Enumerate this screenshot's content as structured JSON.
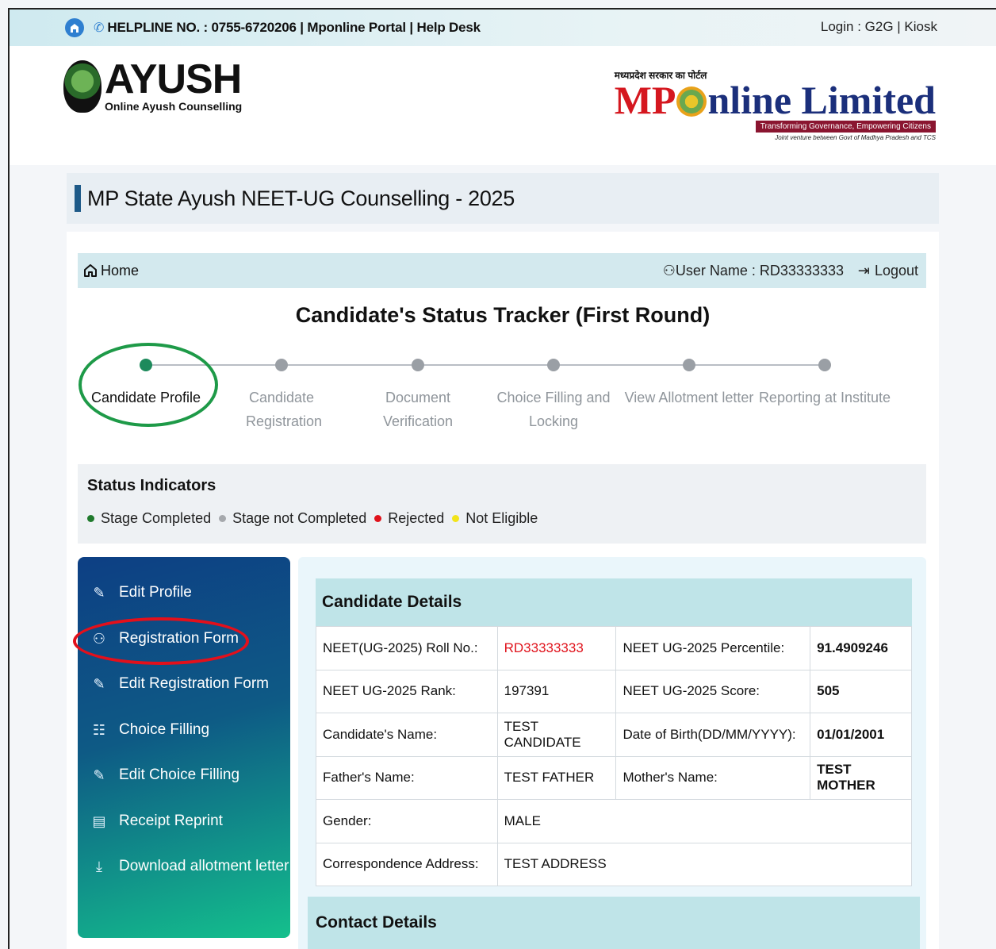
{
  "topbar": {
    "helpline": "HELPLINE NO. : 0755-6720206 | Mponline Portal | Help Desk",
    "login": "Login : G2G | Kiosk"
  },
  "header": {
    "ayush_title": "AYUSH",
    "ayush_subtitle": "Online Ayush Counselling",
    "mp_hindi": "मध्यप्रदेश सरकार का पोर्टल",
    "mp_brand_prefix": "MP",
    "mp_brand_suffix": "nline Limited",
    "mp_tagline": "Transforming Governance, Empowering Citizens",
    "mp_jv": "Joint venture between Govt of Madhya Pradesh and TCS"
  },
  "page_title": "MP State Ayush NEET-UG Counselling - 2025",
  "nav": {
    "home": "Home",
    "user": "User Name : RD33333333",
    "logout": "Logout"
  },
  "tracker": {
    "title": "Candidate's Status Tracker (First Round)",
    "steps": [
      {
        "label": "Candidate Profile",
        "done": true
      },
      {
        "label": "Candidate Registration",
        "done": false
      },
      {
        "label": "Document Verification",
        "done": false
      },
      {
        "label": "Choice Filling and Locking",
        "done": false
      },
      {
        "label": "View Allotment letter",
        "done": false
      },
      {
        "label": "Reporting at Institute",
        "done": false
      }
    ]
  },
  "status": {
    "heading": "Status Indicators",
    "items": [
      {
        "label": "Stage Completed",
        "color": "#1f7a2c"
      },
      {
        "label": "Stage not Completed",
        "color": "#a6a9ad"
      },
      {
        "label": "Rejected",
        "color": "#e0121b"
      },
      {
        "label": "Not Eligible",
        "color": "#f2e41a"
      }
    ]
  },
  "sidebar": {
    "items": [
      {
        "label": "Edit Profile",
        "icon": "edit-icon"
      },
      {
        "label": "Registration Form",
        "icon": "user-plus-icon"
      },
      {
        "label": "Edit Registration Form",
        "icon": "edit-icon"
      },
      {
        "label": "Choice Filling",
        "icon": "list-icon"
      },
      {
        "label": "Edit Choice Filling",
        "icon": "edit-icon"
      },
      {
        "label": "Receipt Reprint",
        "icon": "receipt-icon"
      },
      {
        "label": "Download allotment letter",
        "icon": "download-icon"
      }
    ]
  },
  "details": {
    "heading": "Candidate Details",
    "rows": [
      {
        "k1": "NEET(UG-2025) Roll No.:",
        "v1": "RD33333333",
        "k2": "NEET UG-2025 Percentile:",
        "v2": "91.4909246"
      },
      {
        "k1": "NEET UG-2025 Rank:",
        "v1": "197391",
        "k2": "NEET UG-2025 Score:",
        "v2": "505"
      },
      {
        "k1": "Candidate's Name:",
        "v1": "TEST CANDIDATE",
        "k2": "Date of Birth(DD/MM/YYYY):",
        "v2": "01/01/2001"
      },
      {
        "k1": "Father's Name:",
        "v1": "TEST FATHER",
        "k2": "Mother's Name:",
        "v2": "TEST MOTHER"
      }
    ],
    "gender_label": "Gender:",
    "gender_value": "MALE",
    "address_label": "Correspondence Address:",
    "address_value": "TEST ADDRESS"
  },
  "contact_heading": "Contact Details"
}
